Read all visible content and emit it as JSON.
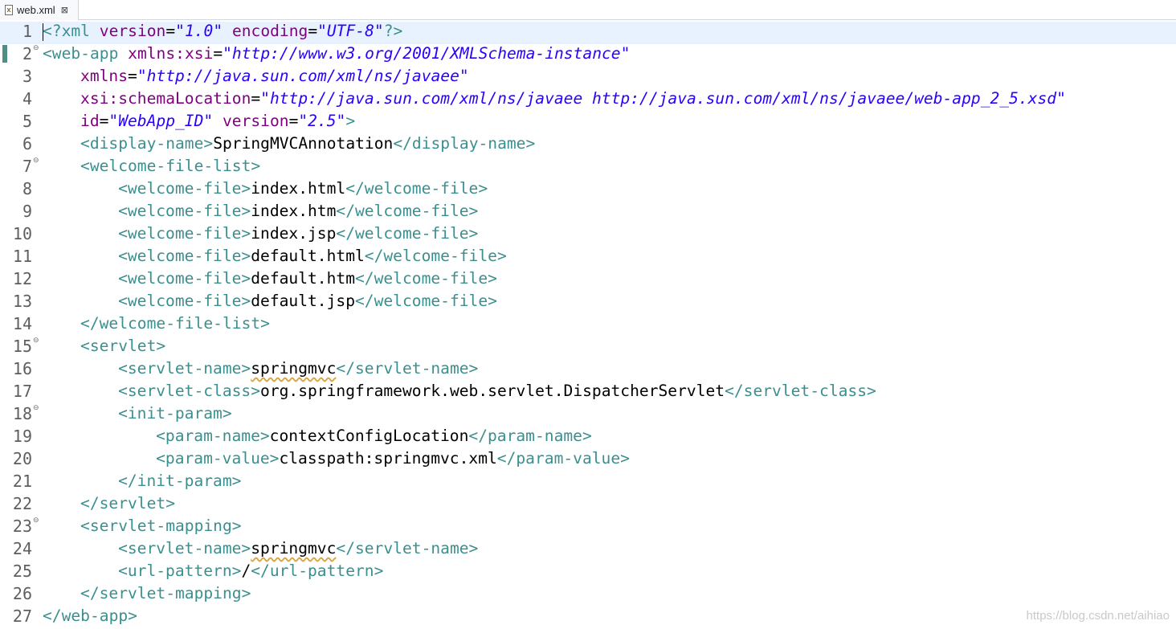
{
  "tab": {
    "icon_label": "X",
    "label": "web.xml",
    "close_glyph": "⊠"
  },
  "fold_glyph": "⊖",
  "lines": [
    {
      "n": "1",
      "current": true,
      "caret": true,
      "fold": false,
      "indent": 0,
      "parts": [
        [
          "pi",
          "<?xml "
        ],
        [
          "attr",
          "version"
        ],
        [
          "eq",
          "="
        ],
        [
          "val",
          "\"1.0\""
        ],
        [
          "eq",
          " "
        ],
        [
          "attr",
          "encoding"
        ],
        [
          "eq",
          "="
        ],
        [
          "val",
          "\"UTF-8\""
        ],
        [
          "pi",
          "?>"
        ]
      ]
    },
    {
      "n": "2",
      "fold": true,
      "indent": 0,
      "parts": [
        [
          "tag",
          "<web-app "
        ],
        [
          "attr",
          "xmlns:xsi"
        ],
        [
          "eq",
          "="
        ],
        [
          "val",
          "\"http://www.w3.org/2001/XMLSchema-instance\""
        ]
      ]
    },
    {
      "n": "3",
      "indent": 4,
      "parts": [
        [
          "attr",
          "xmlns"
        ],
        [
          "eq",
          "="
        ],
        [
          "val",
          "\"http://java.sun.com/xml/ns/javaee\""
        ]
      ]
    },
    {
      "n": "4",
      "indent": 4,
      "parts": [
        [
          "attr",
          "xsi:schemaLocation"
        ],
        [
          "eq",
          "="
        ],
        [
          "val",
          "\"http://java.sun.com/xml/ns/javaee http://java.sun.com/xml/ns/javaee/web-app_2_5.xsd\""
        ]
      ]
    },
    {
      "n": "5",
      "indent": 4,
      "parts": [
        [
          "attr",
          "id"
        ],
        [
          "eq",
          "="
        ],
        [
          "val",
          "\"WebApp_ID\""
        ],
        [
          "eq",
          " "
        ],
        [
          "attr",
          "version"
        ],
        [
          "eq",
          "="
        ],
        [
          "val",
          "\"2.5\""
        ],
        [
          "tag",
          ">"
        ]
      ]
    },
    {
      "n": "6",
      "indent": 4,
      "parts": [
        [
          "tag",
          "<display-name>"
        ],
        [
          "text",
          "SpringMVCAnnotation"
        ],
        [
          "tag",
          "</display-name>"
        ]
      ]
    },
    {
      "n": "7",
      "fold": true,
      "indent": 4,
      "parts": [
        [
          "tag",
          "<welcome-file-list>"
        ]
      ]
    },
    {
      "n": "8",
      "indent": 8,
      "parts": [
        [
          "tag",
          "<welcome-file>"
        ],
        [
          "text",
          "index.html"
        ],
        [
          "tag",
          "</welcome-file>"
        ]
      ]
    },
    {
      "n": "9",
      "indent": 8,
      "parts": [
        [
          "tag",
          "<welcome-file>"
        ],
        [
          "text",
          "index.htm"
        ],
        [
          "tag",
          "</welcome-file>"
        ]
      ]
    },
    {
      "n": "10",
      "indent": 8,
      "parts": [
        [
          "tag",
          "<welcome-file>"
        ],
        [
          "text",
          "index.jsp"
        ],
        [
          "tag",
          "</welcome-file>"
        ]
      ]
    },
    {
      "n": "11",
      "indent": 8,
      "parts": [
        [
          "tag",
          "<welcome-file>"
        ],
        [
          "text",
          "default.html"
        ],
        [
          "tag",
          "</welcome-file>"
        ]
      ]
    },
    {
      "n": "12",
      "indent": 8,
      "parts": [
        [
          "tag",
          "<welcome-file>"
        ],
        [
          "text",
          "default.htm"
        ],
        [
          "tag",
          "</welcome-file>"
        ]
      ]
    },
    {
      "n": "13",
      "indent": 8,
      "parts": [
        [
          "tag",
          "<welcome-file>"
        ],
        [
          "text",
          "default.jsp"
        ],
        [
          "tag",
          "</welcome-file>"
        ]
      ]
    },
    {
      "n": "14",
      "indent": 4,
      "parts": [
        [
          "tag",
          "</welcome-file-list>"
        ]
      ]
    },
    {
      "n": "15",
      "fold": true,
      "indent": 4,
      "parts": [
        [
          "tag",
          "<servlet>"
        ]
      ]
    },
    {
      "n": "16",
      "indent": 8,
      "parts": [
        [
          "tag",
          "<servlet-name>"
        ],
        [
          "squiggle",
          "springmvc"
        ],
        [
          "tag",
          "</servlet-name>"
        ]
      ]
    },
    {
      "n": "17",
      "indent": 8,
      "parts": [
        [
          "tag",
          "<servlet-class>"
        ],
        [
          "text",
          "org.springframework.web.servlet.DispatcherServlet"
        ],
        [
          "tag",
          "</servlet-class>"
        ]
      ]
    },
    {
      "n": "18",
      "fold": true,
      "indent": 8,
      "parts": [
        [
          "tag",
          "<init-param>"
        ]
      ]
    },
    {
      "n": "19",
      "indent": 12,
      "parts": [
        [
          "tag",
          "<param-name>"
        ],
        [
          "text",
          "contextConfigLocation"
        ],
        [
          "tag",
          "</param-name>"
        ]
      ]
    },
    {
      "n": "20",
      "indent": 12,
      "parts": [
        [
          "tag",
          "<param-value>"
        ],
        [
          "text",
          "classpath:springmvc.xml"
        ],
        [
          "tag",
          "</param-value>"
        ]
      ]
    },
    {
      "n": "21",
      "indent": 8,
      "parts": [
        [
          "tag",
          "</init-param>"
        ]
      ]
    },
    {
      "n": "22",
      "indent": 4,
      "parts": [
        [
          "tag",
          "</servlet>"
        ]
      ]
    },
    {
      "n": "23",
      "fold": true,
      "indent": 4,
      "parts": [
        [
          "tag",
          "<servlet-mapping>"
        ]
      ]
    },
    {
      "n": "24",
      "indent": 8,
      "parts": [
        [
          "tag",
          "<servlet-name>"
        ],
        [
          "squiggle",
          "springmvc"
        ],
        [
          "tag",
          "</servlet-name>"
        ]
      ]
    },
    {
      "n": "25",
      "indent": 8,
      "parts": [
        [
          "tag",
          "<url-pattern>"
        ],
        [
          "text",
          "/"
        ],
        [
          "tag",
          "</url-pattern>"
        ]
      ]
    },
    {
      "n": "26",
      "indent": 4,
      "parts": [
        [
          "tag",
          "</servlet-mapping>"
        ]
      ]
    },
    {
      "n": "27",
      "indent": 0,
      "parts": [
        [
          "tag",
          "</web-app>"
        ]
      ]
    }
  ],
  "watermark": "https://blog.csdn.net/aihiao"
}
